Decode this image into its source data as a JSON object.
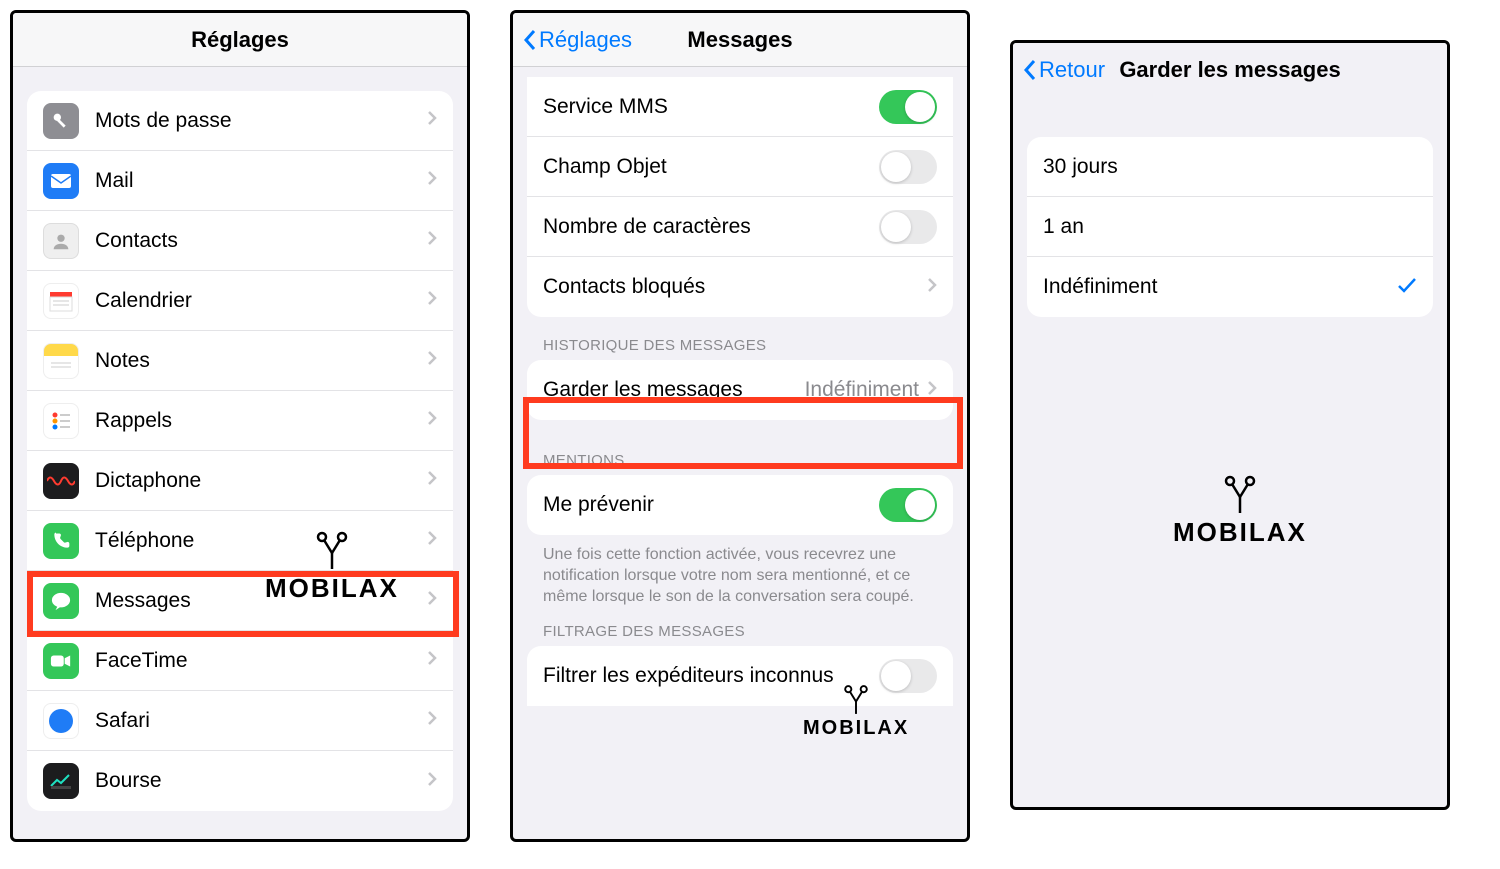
{
  "watermark_brand": "MOBILAX",
  "screen1": {
    "title": "Réglages",
    "items": [
      {
        "label": "Mots de passe",
        "icon": "key-icon",
        "bg": "#8e8e93"
      },
      {
        "label": "Mail",
        "icon": "mail-icon",
        "bg": "#1f7cf6"
      },
      {
        "label": "Contacts",
        "icon": "contacts-icon",
        "bg": "#e6e6e8"
      },
      {
        "label": "Calendrier",
        "icon": "calendar-icon",
        "bg": "#ffffff"
      },
      {
        "label": "Notes",
        "icon": "notes-icon",
        "bg": "#ffffff"
      },
      {
        "label": "Rappels",
        "icon": "reminders-icon",
        "bg": "#ffffff"
      },
      {
        "label": "Dictaphone",
        "icon": "voice-memo-icon",
        "bg": "#1c1c1e"
      },
      {
        "label": "Téléphone",
        "icon": "phone-icon",
        "bg": "#34c759"
      },
      {
        "label": "Messages",
        "icon": "messages-icon",
        "bg": "#34c759",
        "highlighted": true
      },
      {
        "label": "FaceTime",
        "icon": "facetime-icon",
        "bg": "#34c759"
      },
      {
        "label": "Safari",
        "icon": "safari-icon",
        "bg": "#ffffff"
      },
      {
        "label": "Bourse",
        "icon": "stocks-icon",
        "bg": "#1c1c1e"
      }
    ]
  },
  "screen2": {
    "back": "Réglages",
    "title": "Messages",
    "group_mms": [
      {
        "label": "Service MMS",
        "type": "switch",
        "on": true
      },
      {
        "label": "Champ Objet",
        "type": "switch",
        "on": false
      },
      {
        "label": "Nombre de caractères",
        "type": "switch",
        "on": false
      },
      {
        "label": "Contacts bloqués",
        "type": "disclosure"
      }
    ],
    "section_history": "HISTORIQUE DES MESSAGES",
    "keep_row": {
      "label": "Garder les messages",
      "value": "Indéfiniment",
      "highlighted": true
    },
    "section_mentions": "MENTIONS",
    "mention_row": {
      "label": "Me prévenir",
      "type": "switch",
      "on": true
    },
    "mention_footer": "Une fois cette fonction activée, vous recevrez une notification lorsque votre nom sera mentionné, et ce même lorsque le son de la conversation sera coupé.",
    "section_filter": "FILTRAGE DES MESSAGES",
    "filter_row": {
      "label": "Filtrer les expéditeurs inconnus",
      "type": "switch",
      "on": false
    }
  },
  "screen3": {
    "back": "Retour",
    "title": "Garder les messages",
    "options": [
      {
        "label": "30 jours",
        "selected": false
      },
      {
        "label": "1 an",
        "selected": false
      },
      {
        "label": "Indéfiniment",
        "selected": true
      }
    ]
  }
}
